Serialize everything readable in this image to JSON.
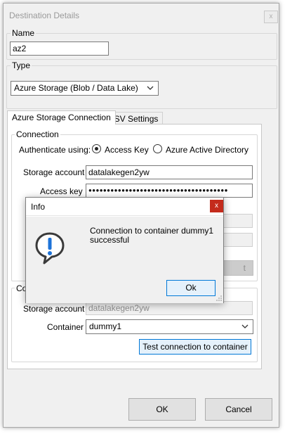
{
  "window": {
    "title": "Destination Details",
    "close_glyph": "x"
  },
  "name_group": {
    "label": "Name",
    "value": "az2"
  },
  "type_group": {
    "label": "Type",
    "selected": "Azure Storage (Blob / Data Lake)"
  },
  "tabs": [
    {
      "label": "Azure Storage Connection",
      "active": true
    },
    {
      "label": "CSV Settings",
      "active": false
    }
  ],
  "connection": {
    "label": "Connection",
    "auth_label": "Authenticate using:",
    "auth_options": [
      {
        "label": "Access Key",
        "checked": true
      },
      {
        "label": "Azure Active Directory",
        "checked": false
      }
    ],
    "storage_account_label": "Storage account",
    "storage_account_value": "datalakegen2yw",
    "access_key_label": "Access key",
    "access_key_value": "●●●●●●●●●●●●●●●●●●●●●●●●●●●●●●●●●●●●●●",
    "hidden_button_fragment": "t"
  },
  "container_group": {
    "label_fragment": "Co",
    "storage_account_label": "Storage account",
    "storage_account_value": "datalakegen2yw",
    "container_label": "Container",
    "container_value": "dummy1",
    "test_button": "Test connection to container"
  },
  "footer": {
    "ok": "OK",
    "cancel": "Cancel"
  },
  "info_dialog": {
    "title": "Info",
    "close_glyph": "x",
    "message": "Connection to container dummy1 successful",
    "ok": "Ok",
    "icon": "speech-bubble-exclamation-icon"
  },
  "colors": {
    "accent": "#0078d7",
    "close_red": "#c42b1c"
  }
}
